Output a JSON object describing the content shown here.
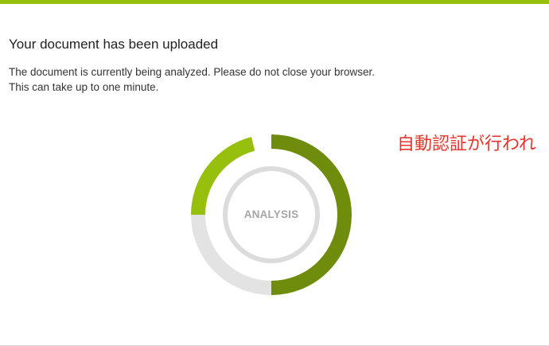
{
  "page": {
    "title": "Your document has been uploaded",
    "message_line1": "The document is currently being analyzed. Please do not close your browser.",
    "message_line2": "This can take up to one minute."
  },
  "progress": {
    "label": "ANALYSIS",
    "segments": [
      {
        "name": "dark-green",
        "from": 0.0,
        "to": 0.5,
        "color": "#6f8c0c"
      },
      {
        "name": "light-gray",
        "from": 0.5,
        "to": 0.75,
        "color": "#e3e3e3"
      },
      {
        "name": "light-green",
        "from": 0.75,
        "to": 0.96,
        "color": "#97bf0d"
      }
    ],
    "inner_ring_color": "#dcdcdc"
  },
  "annotation": {
    "text": "自動認証が行われ"
  },
  "colors": {
    "accent": "#97bf0d",
    "accent_dark": "#6f8c0c",
    "annotation": "#e8342c"
  }
}
